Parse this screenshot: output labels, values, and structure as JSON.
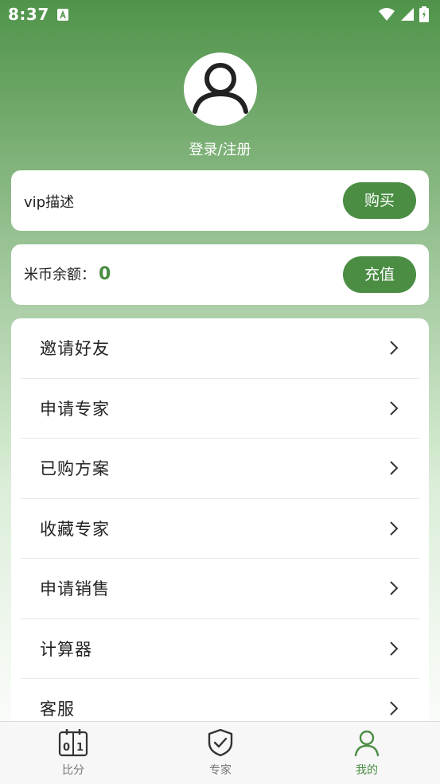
{
  "status_bar": {
    "time": "8:37"
  },
  "profile": {
    "login_label": "登录/注册"
  },
  "vip": {
    "description": "vip描述",
    "buy_label": "购买"
  },
  "coins": {
    "label": "米币余额：",
    "amount": "0",
    "recharge_label": "充值"
  },
  "menu": {
    "items": [
      {
        "label": "邀请好友"
      },
      {
        "label": "申请专家"
      },
      {
        "label": "已购方案"
      },
      {
        "label": "收藏专家"
      },
      {
        "label": "申请销售"
      },
      {
        "label": "计算器"
      },
      {
        "label": "客服"
      }
    ]
  },
  "tabbar": {
    "tabs": [
      {
        "label": "比分",
        "icon": "scoreboard-icon"
      },
      {
        "label": "专家",
        "icon": "shield-check-icon"
      },
      {
        "label": "我的",
        "icon": "person-icon",
        "active": true
      }
    ]
  },
  "colors": {
    "accent": "#4a8d43",
    "header_top": "#4f944a"
  }
}
